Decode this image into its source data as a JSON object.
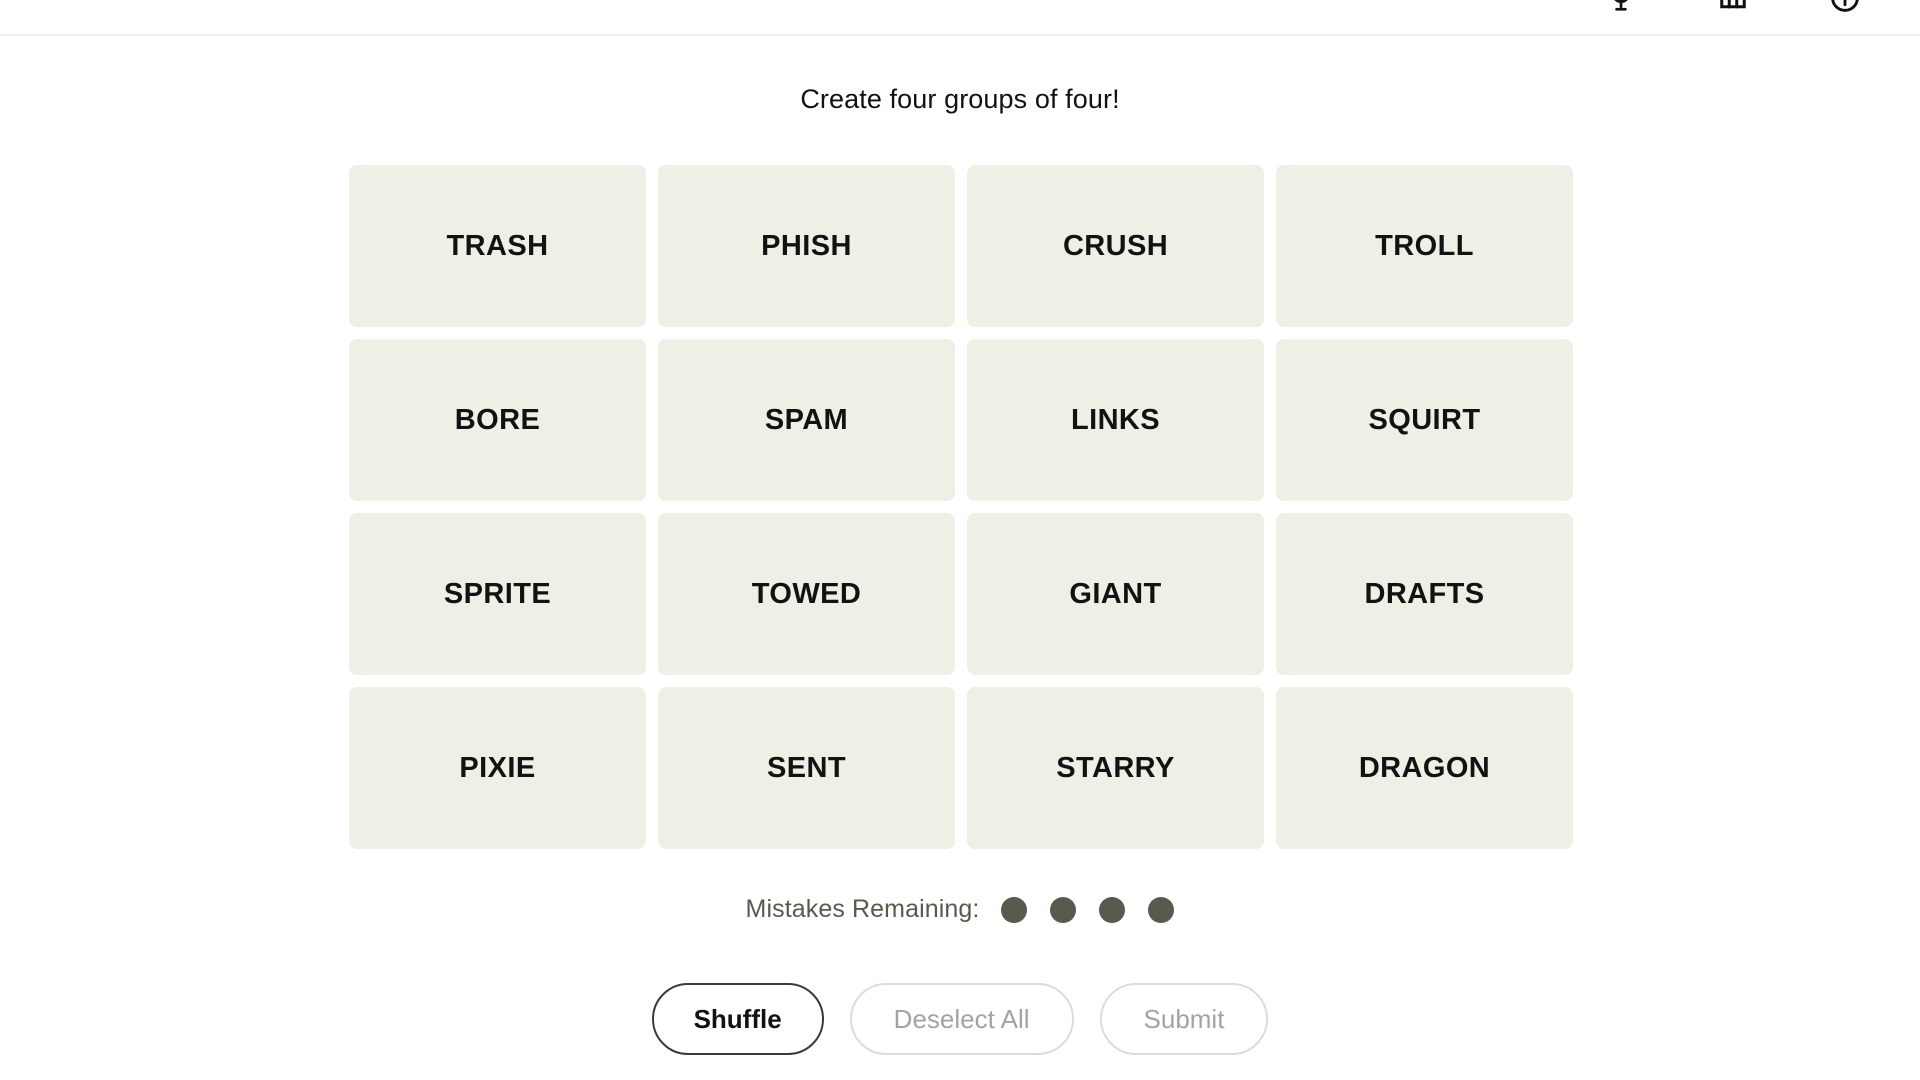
{
  "topbar": {
    "icons": [
      {
        "name": "trophy-icon",
        "label": "Achievements"
      },
      {
        "name": "stats-bar-chart-icon",
        "label": "Stats"
      },
      {
        "name": "help-circle-icon",
        "label": "Help"
      }
    ]
  },
  "headline": "Create four groups of four!",
  "board": {
    "rows": [
      [
        "TRASH",
        "PHISH",
        "CRUSH",
        "TROLL"
      ],
      [
        "BORE",
        "SPAM",
        "LINKS",
        "SQUIRT"
      ],
      [
        "SPRITE",
        "TOWED",
        "GIANT",
        "DRAFTS"
      ],
      [
        "PIXIE",
        "SENT",
        "STARRY",
        "DRAGON"
      ]
    ],
    "tiles": [
      "TRASH",
      "PHISH",
      "CRUSH",
      "TROLL",
      "BORE",
      "SPAM",
      "LINKS",
      "SQUIRT",
      "SPRITE",
      "TOWED",
      "GIANT",
      "DRAFTS",
      "PIXIE",
      "SENT",
      "STARRY",
      "DRAGON"
    ],
    "tile_color": "#EFEFE6",
    "tile_text_color": "#121212"
  },
  "mistakes": {
    "label": "Mistakes Remaining:",
    "remaining": 4,
    "dots": [
      1,
      2,
      3,
      4
    ],
    "dot_color": "#5A594E"
  },
  "actions": {
    "shuffle_label": "Shuffle",
    "deselect_label": "Deselect All",
    "submit_label": "Submit",
    "active_color": "#121212",
    "disabled_color": "#A3A3A3"
  }
}
